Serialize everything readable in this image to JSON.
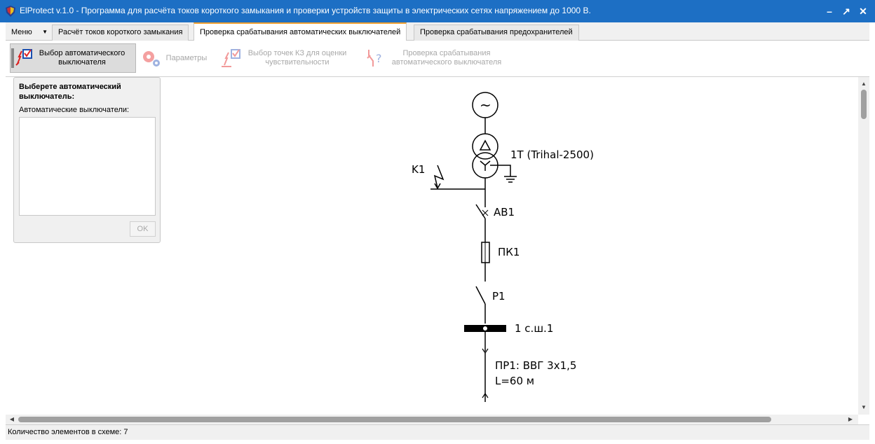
{
  "window": {
    "title": "ElProtect v.1.0 - Программа для расчёта токов короткого замыкания и проверки устройств защиты в электрических сетях напряжением до 1000 В.",
    "icon": "shield-icon",
    "controls": [
      "minimize-icon",
      "maximize-icon",
      "close-icon"
    ]
  },
  "menu": {
    "label": "Меню"
  },
  "tabs": [
    {
      "label": "Расчёт токов короткого замыкания",
      "active": false
    },
    {
      "label": "Проверка срабатывания автоматических выключателей",
      "active": true
    },
    {
      "label": "Проверка срабатывания предохранителей",
      "active": false
    }
  ],
  "ribbon": {
    "buttons": [
      {
        "label_line1": "Выбор автоматического",
        "label_line2": "выключателя",
        "icon": "breaker-check-icon",
        "state": "selected"
      },
      {
        "label_line1": "Параметры",
        "label_line2": "",
        "icon": "gears-icon",
        "state": "disabled"
      },
      {
        "label_line1": "Выбор точек КЗ для оценки",
        "label_line2": "чувствительности",
        "icon": "fault-point-check-icon",
        "state": "disabled"
      },
      {
        "label_line1": "Проверка срабатывания",
        "label_line2": "автоматического выключателя",
        "icon": "breaker-question-icon",
        "state": "disabled"
      }
    ]
  },
  "panel": {
    "title": "Выберете автоматический выключатель:",
    "list_label": "Автоматические выключатели:",
    "items": [],
    "ok_label": "OK"
  },
  "diagram": {
    "transformer": "1T (Trihal-2500)",
    "fault": "K1",
    "breaker": "AB1",
    "fuse": "ПК1",
    "switch": "P1",
    "bus": "1 с.ш.1",
    "cable_name": "ПР1: ВВГ 3х1,5",
    "cable_length": "L=60 м",
    "source_symbol": "~"
  },
  "status": {
    "text": "Количество элементов в схеме: 7"
  },
  "colors": {
    "titlebar": "#1d6fc4",
    "active_tab_accent": "#f0a030"
  }
}
